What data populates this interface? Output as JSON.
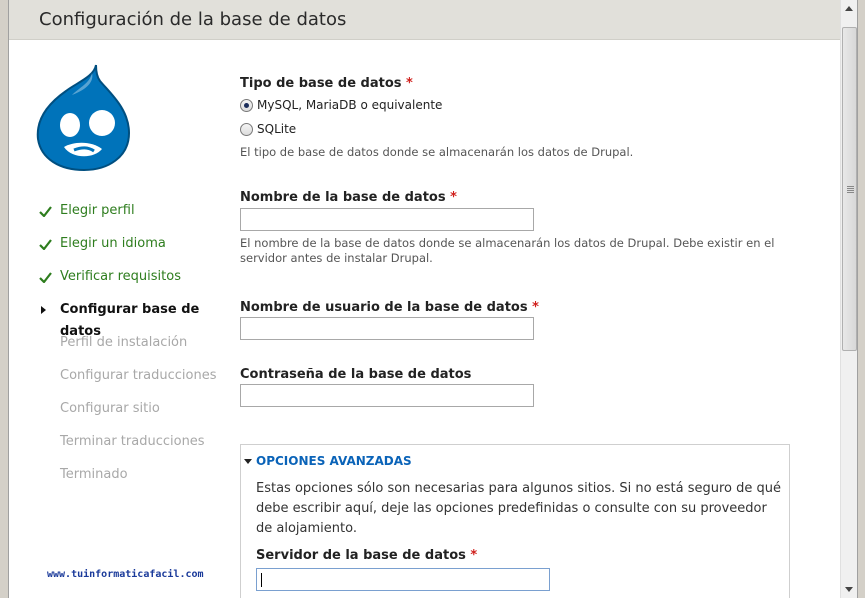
{
  "header": {
    "title": "Configuración de la base de datos"
  },
  "steps": [
    {
      "label": "Elegir perfil",
      "state": "done"
    },
    {
      "label": "Elegir un idioma",
      "state": "done"
    },
    {
      "label": "Verificar requisitos",
      "state": "done"
    },
    {
      "label": "Configurar base de datos",
      "state": "active"
    },
    {
      "label": "Perfil de instalación",
      "state": "pending"
    },
    {
      "label": "Configurar traducciones",
      "state": "pending"
    },
    {
      "label": "Configurar sitio",
      "state": "pending"
    },
    {
      "label": "Terminar traducciones",
      "state": "pending"
    },
    {
      "label": "Terminado",
      "state": "pending"
    }
  ],
  "form": {
    "db_type": {
      "label": "Tipo de base de datos",
      "required_mark": "*",
      "options": [
        "MySQL, MariaDB o equivalente",
        "SQLite"
      ],
      "selected": "MySQL, MariaDB o equivalente",
      "description": "El tipo de base de datos donde se almacenarán los datos de Drupal."
    },
    "db_name": {
      "label": "Nombre de la base de datos",
      "required_mark": "*",
      "value": "",
      "description_line1": "El nombre de la base de datos donde se almacenarán los datos de Drupal. Debe existir en el",
      "description_line2": "servidor antes de instalar Drupal."
    },
    "db_user": {
      "label": "Nombre de usuario de la base de datos",
      "required_mark": "*",
      "value": ""
    },
    "db_pass": {
      "label": "Contraseña de la base de datos",
      "value": ""
    },
    "advanced": {
      "legend": "OPCIONES AVANZADAS",
      "description": "Estas opciones sólo son necesarias para algunos sitios. Si no está seguro de qué debe escribir aquí, deje las opciones predefinidas o consulte con su proveedor de alojamiento.",
      "host_label": "Servidor de la base de datos",
      "required_mark": "*",
      "host_value": ""
    }
  },
  "watermark": "www.tuinformaticafacil.com",
  "colors": {
    "done": "#2e7d1e",
    "pending": "#a8a8a8",
    "link": "#0a63b8",
    "required": "#d0201c",
    "logo": "#0073ba"
  },
  "icons": {
    "logo": "drupal-drop-logo",
    "done": "check-icon",
    "active": "arrow-right-icon",
    "legend": "triangle-down-icon"
  }
}
